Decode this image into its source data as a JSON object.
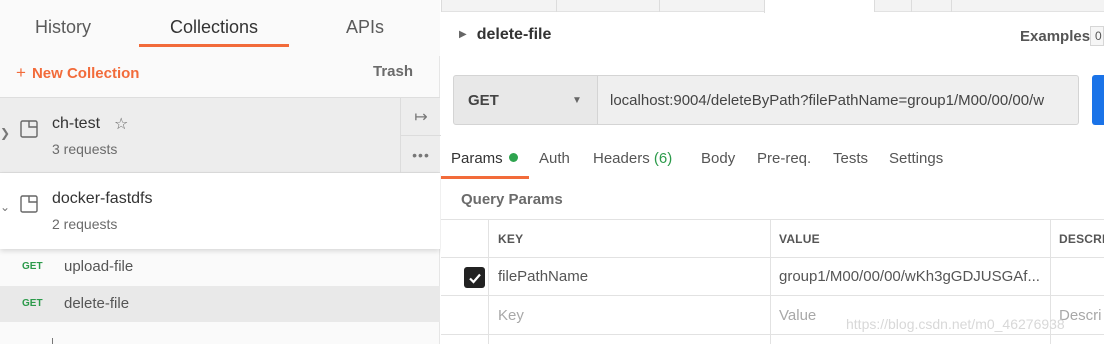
{
  "sidebar": {
    "tabs": [
      {
        "label": "History"
      },
      {
        "label": "Collections"
      },
      {
        "label": "APIs"
      }
    ],
    "new_collection_label": "New Collection",
    "new_collection_icon": "+",
    "trash_label": "Trash",
    "collections": [
      {
        "name": "ch-test",
        "requests": "3 requests",
        "starred": true
      },
      {
        "name": "docker-fastdfs",
        "requests": "2 requests",
        "expanded": true
      }
    ],
    "requests": [
      {
        "method": "GET",
        "name": "upload-file"
      },
      {
        "method": "GET",
        "name": "delete-file",
        "selected": true
      }
    ]
  },
  "request": {
    "title": "delete-file",
    "examples_label": "Examples",
    "examples_count": "0",
    "method": "GET",
    "url": "localhost:9004/deleteByPath?filePathName=group1/M00/00/00/w"
  },
  "subtabs": {
    "params": "Params",
    "auth": "Auth",
    "headers": "Headers",
    "headers_count": "(6)",
    "body": "Body",
    "prereq": "Pre-req.",
    "tests": "Tests",
    "settings": "Settings"
  },
  "query_params": {
    "label": "Query Params",
    "columns": [
      "KEY",
      "VALUE",
      "DESCRI"
    ],
    "rows": [
      {
        "checked": true,
        "key": "filePathName",
        "value": "group1/M00/00/00/wKh3gGDJUSGAf...",
        "description": ""
      }
    ],
    "placeholders": {
      "key": "Key",
      "value": "Value",
      "description": "Descri"
    }
  },
  "watermark": "https://blog.csdn.net/m0_46276938",
  "colors": {
    "accent": "#f26b3a",
    "get_method": "#2b9a4a",
    "send_button": "#1a73e8"
  }
}
